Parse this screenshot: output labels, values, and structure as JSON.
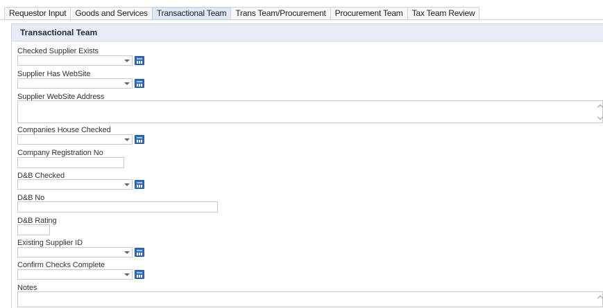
{
  "tabs": [
    {
      "label": "Requestor Input"
    },
    {
      "label": "Goods and Services"
    },
    {
      "label": "Transactional Team"
    },
    {
      "label": "Trans Team/Procurement"
    },
    {
      "label": "Procurement Team"
    },
    {
      "label": "Tax Team Review"
    }
  ],
  "active_tab": "Transactional Team",
  "panel": {
    "title": "Transactional Team"
  },
  "fields": {
    "checked_supplier_exists": {
      "label": "Checked Supplier Exists",
      "value": ""
    },
    "supplier_has_website": {
      "label": "Supplier Has WebSite",
      "value": ""
    },
    "supplier_website_address": {
      "label": "Supplier WebSite Address",
      "value": ""
    },
    "companies_house_checked": {
      "label": "Companies House Checked",
      "value": ""
    },
    "company_registration_no": {
      "label": "Company Registration No",
      "value": ""
    },
    "db_checked": {
      "label": "D&B Checked",
      "value": ""
    },
    "db_no": {
      "label": "D&B No",
      "value": ""
    },
    "db_rating": {
      "label": "D&B Rating",
      "value": ""
    },
    "existing_supplier_id": {
      "label": "Existing Supplier ID",
      "value": ""
    },
    "confirm_checks_complete": {
      "label": "Confirm Checks Complete",
      "value": ""
    },
    "notes": {
      "label": "Notes",
      "value": ""
    }
  },
  "colors": {
    "accent": "#2f6cc0",
    "header_bg": "#e7ecf7",
    "active_tab_bg": "#dde9f7"
  }
}
